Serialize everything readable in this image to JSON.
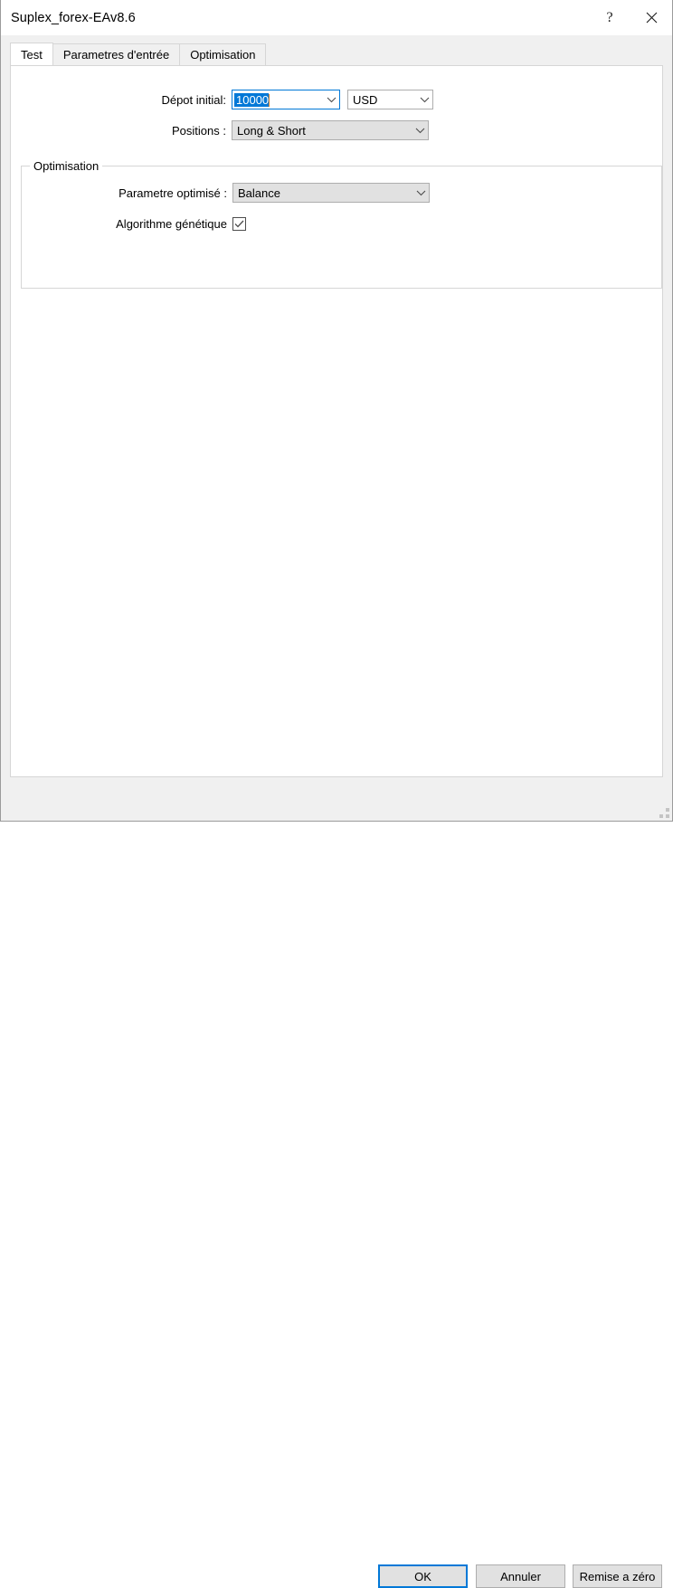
{
  "window": {
    "title": "Suplex_forex-EAv8.6",
    "help_button": "?",
    "close_button": "✕"
  },
  "tabs": [
    {
      "label": "Test",
      "active": true
    },
    {
      "label": "Parametres d'entrée",
      "active": false
    },
    {
      "label": "Optimisation",
      "active": false
    }
  ],
  "test_tab": {
    "deposit": {
      "label": "Dépot initial:",
      "value": "10000",
      "currency_value": "USD"
    },
    "positions": {
      "label": "Positions :",
      "value": "Long & Short"
    },
    "optimisation_group": {
      "title": "Optimisation",
      "parameter": {
        "label": "Parametre optimisé :",
        "value": "Balance"
      },
      "genetic": {
        "label": "Algorithme génétique",
        "checked": "✓"
      }
    }
  },
  "footer": {
    "ok_label": "OK",
    "cancel_label": "Annuler",
    "reset_label": "Remise a zéro"
  },
  "colors": {
    "accent": "#0078d7",
    "selection": "#0078d7",
    "control_face": "#e1e1e1",
    "window_face": "#f0f0f0",
    "border": "#d6d6d6"
  }
}
